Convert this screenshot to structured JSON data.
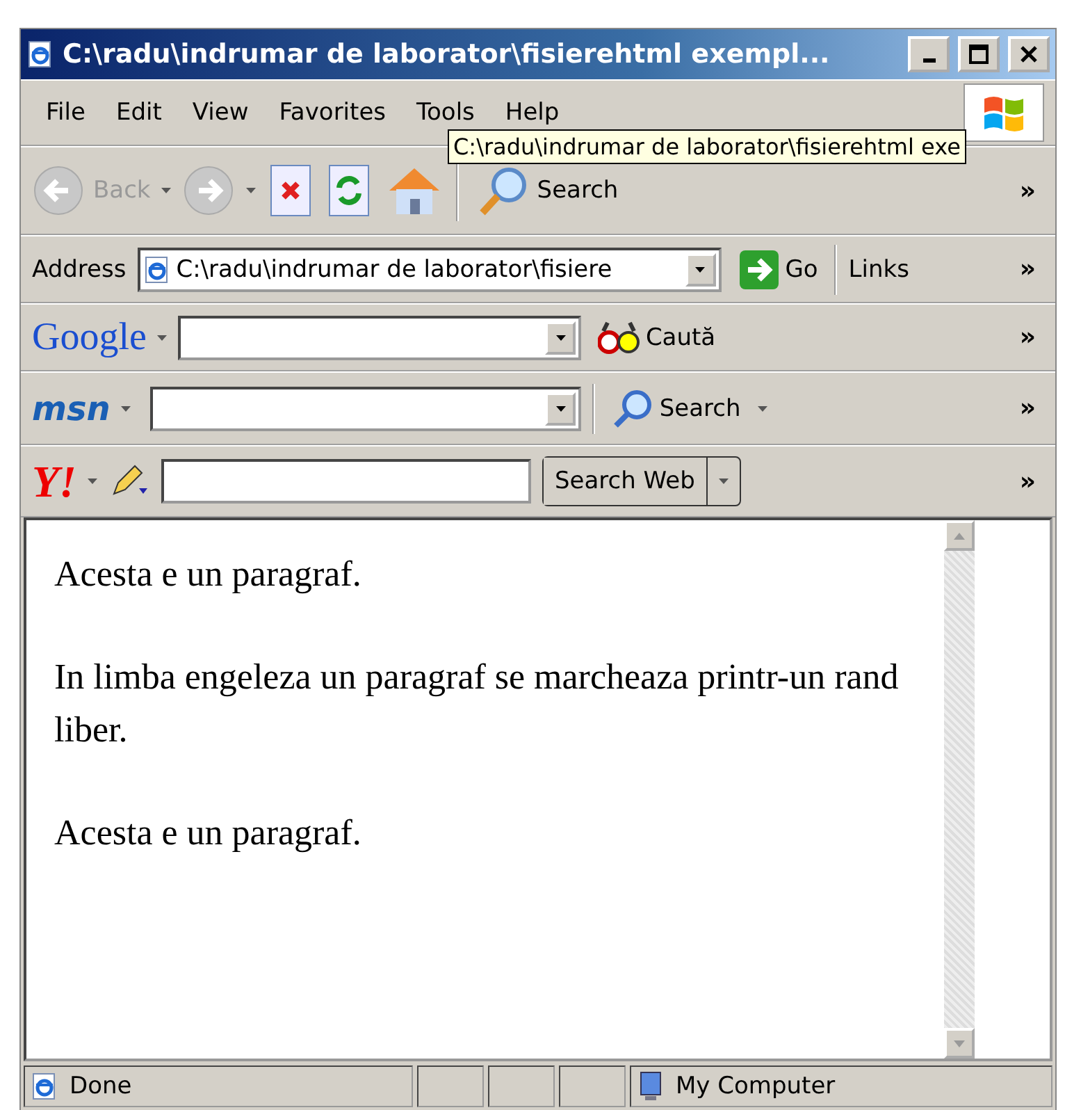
{
  "window": {
    "title": "C:\\radu\\indrumar de laborator\\fisierehtml exempl..."
  },
  "menu": [
    "File",
    "Edit",
    "View",
    "Favorites",
    "Tools",
    "Help"
  ],
  "tooltip": "C:\\radu\\indrumar de laborator\\fisierehtml exe",
  "toolbar": {
    "back": "Back",
    "search": "Search",
    "chevron": "»"
  },
  "address": {
    "label": "Address",
    "value": "C:\\radu\\indrumar de laborator\\fisiere",
    "go": "Go",
    "links": "Links",
    "chevron": "»"
  },
  "google": {
    "logo": "Google",
    "search": "Caută",
    "chevron": "»"
  },
  "msn": {
    "logo": "msn",
    "search": "Search",
    "chevron": "»"
  },
  "yahoo": {
    "logo": "Y!",
    "button": "Search Web",
    "chevron": "»"
  },
  "content": {
    "paragraphs": [
      "Acesta e un paragraf.",
      "In limba engeleza un paragraf se marcheaza printr-un rand liber.",
      "Acesta e un paragraf."
    ]
  },
  "status_bar": {
    "text": "Done",
    "zone": "My Computer"
  }
}
